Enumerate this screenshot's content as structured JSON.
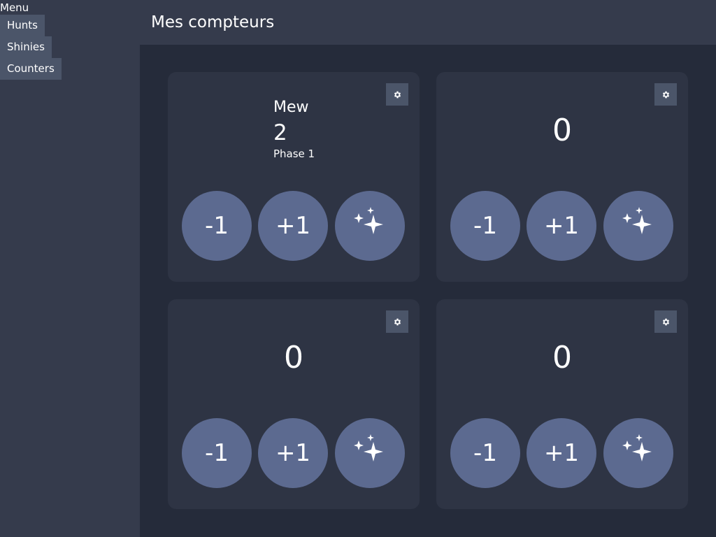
{
  "sidebar": {
    "menu_label": "Menu",
    "items": [
      {
        "label": "Hunts"
      },
      {
        "label": "Shinies"
      },
      {
        "label": "Counters"
      }
    ]
  },
  "header": {
    "title": "Mes compteurs"
  },
  "cards": [
    {
      "name": "Mew",
      "count": "2",
      "phase": "Phase 1",
      "minus_label": "-1",
      "plus_label": "+1",
      "settings_icon": "gear-icon",
      "shiny_icon": "sparkles-icon"
    },
    {
      "count": "0",
      "minus_label": "-1",
      "plus_label": "+1",
      "settings_icon": "gear-icon",
      "shiny_icon": "sparkles-icon"
    },
    {
      "count": "0",
      "minus_label": "-1",
      "plus_label": "+1",
      "settings_icon": "gear-icon",
      "shiny_icon": "sparkles-icon"
    },
    {
      "count": "0",
      "minus_label": "-1",
      "plus_label": "+1",
      "settings_icon": "gear-icon",
      "shiny_icon": "sparkles-icon"
    }
  ],
  "colors": {
    "sidebar_bg": "#353b4c",
    "main_bg": "#252b3a",
    "card_bg": "#2e3444",
    "button_bg": "#5c6a90",
    "nav_item_bg": "#4b5569",
    "text": "#ffffff"
  }
}
